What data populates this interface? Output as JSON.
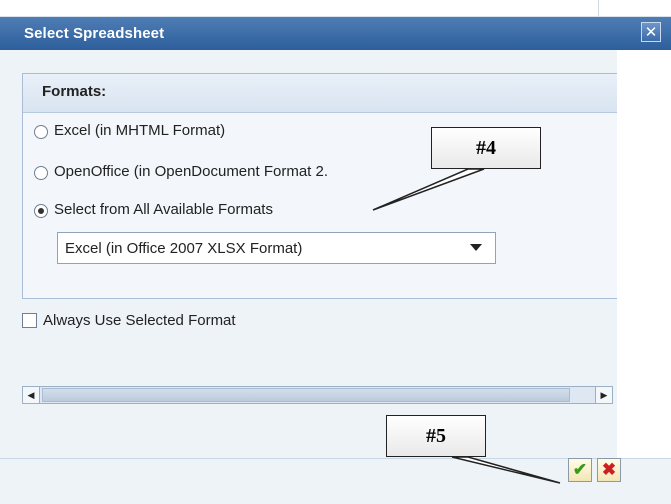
{
  "dialog": {
    "title": "Select Spreadsheet",
    "close_icon": "✕"
  },
  "formats": {
    "header": "Formats:",
    "options": [
      {
        "label": "Excel (in MHTML Format)",
        "selected": false
      },
      {
        "label": "OpenOffice (in OpenDocument Format 2.",
        "selected": false
      },
      {
        "label": "Select from All Available Formats",
        "selected": true
      }
    ],
    "dropdown_value": "Excel (in Office 2007 XLSX Format)"
  },
  "always_use": {
    "label": "Always Use Selected Format",
    "checked": false
  },
  "scrollbar": {
    "left_arrow": "◀",
    "right_arrow": "▶"
  },
  "buttons": {
    "ok_icon": "✔",
    "cancel_icon": "✖"
  },
  "callouts": {
    "c4": "#4",
    "c5": "#5"
  }
}
